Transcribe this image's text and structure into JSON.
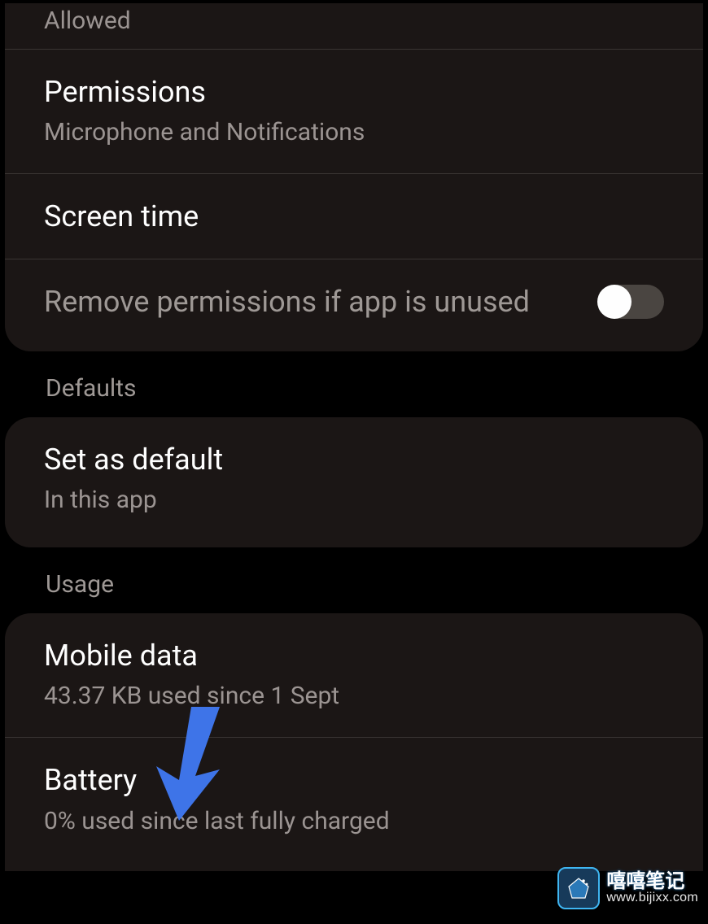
{
  "card1": {
    "allowed_clipped": "Allowed",
    "permissions": {
      "title": "Permissions",
      "subtitle": "Microphone and Notifications"
    },
    "screen_time": {
      "title": "Screen time"
    },
    "remove_permissions": {
      "title": "Remove permissions if app is unused",
      "toggle_on": false
    }
  },
  "defaults_section": {
    "header": "Defaults",
    "set_as_default": {
      "title": "Set as default",
      "subtitle": "In this app"
    }
  },
  "usage_section": {
    "header": "Usage",
    "mobile_data": {
      "title": "Mobile data",
      "subtitle": "43.37 KB used since 1 Sept"
    },
    "battery": {
      "title": "Battery",
      "subtitle": "0% used since last fully charged"
    }
  },
  "watermark": {
    "title": "嘻嘻笔记",
    "url": "www.bijixx.com"
  }
}
